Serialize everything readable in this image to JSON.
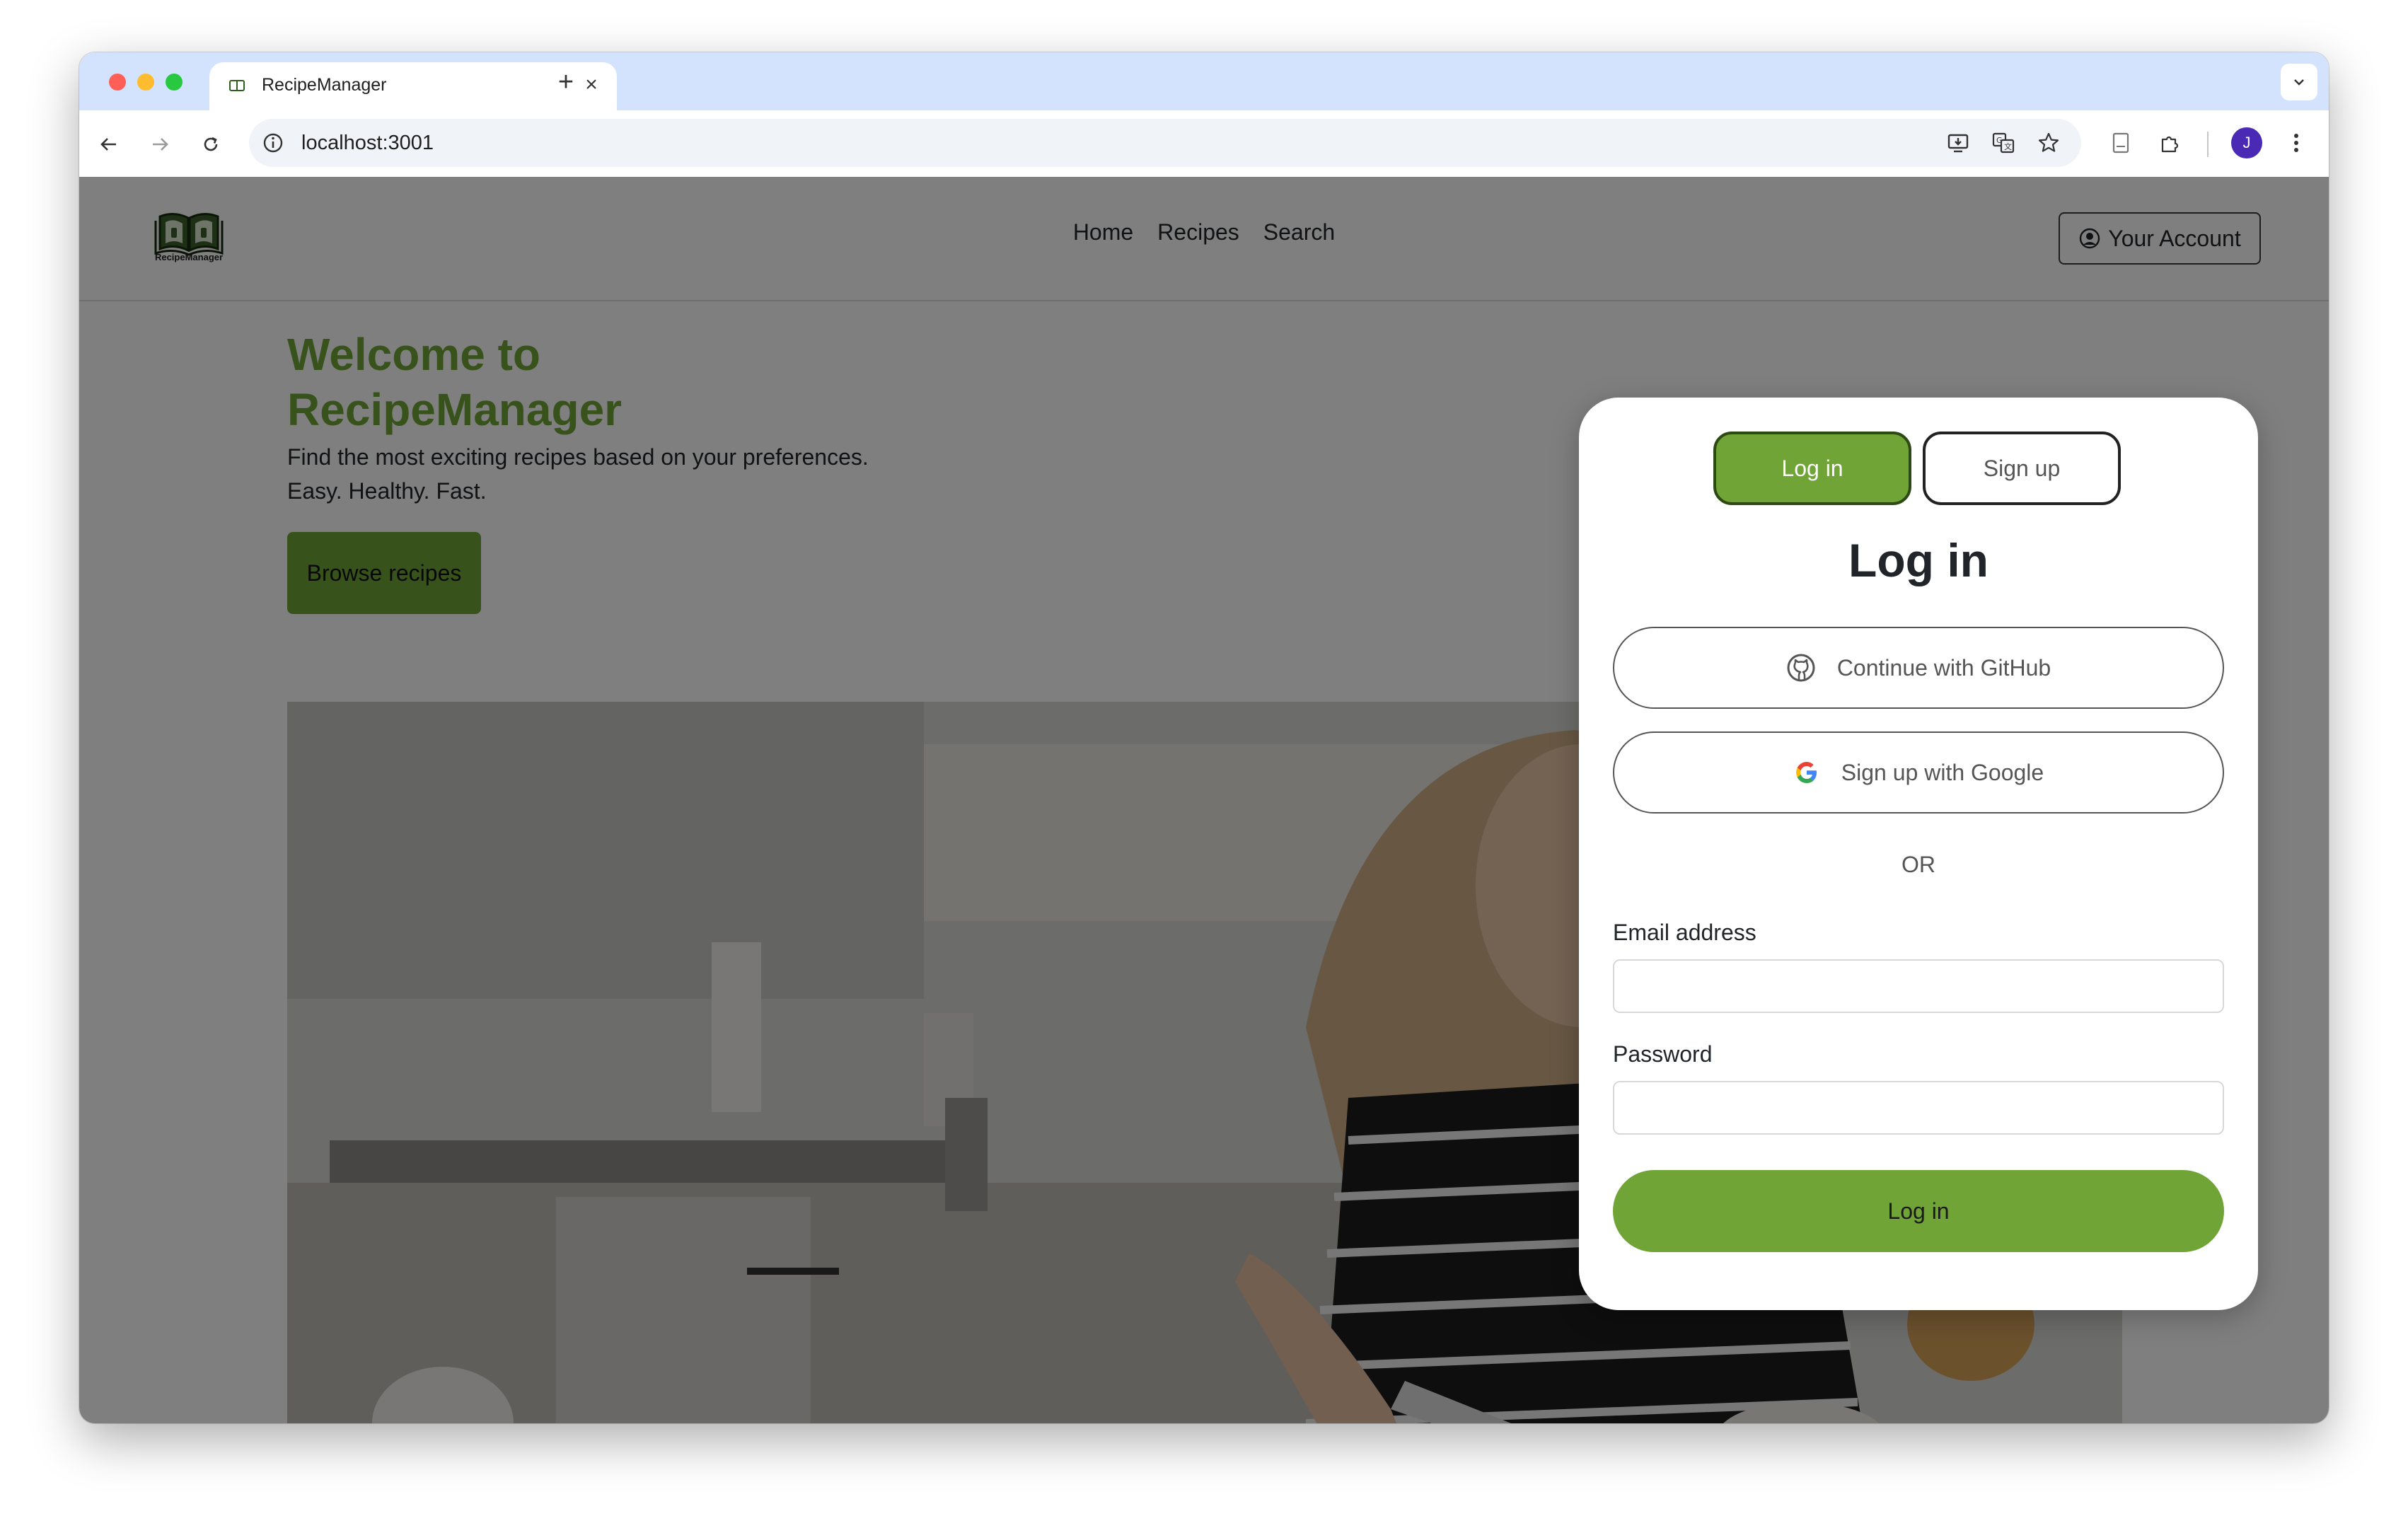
{
  "browser": {
    "tab_title": "RecipeManager",
    "url": "localhost:3001",
    "profile_initial": "J"
  },
  "site": {
    "logo_text": "RecipeManager",
    "nav": [
      "Home",
      "Recipes",
      "Search"
    ],
    "account_label": "Your Account"
  },
  "hero": {
    "title": "Welcome to RecipeManager",
    "line1": "Find the most exciting recipes based on your preferences.",
    "line2": "Easy. Healthy. Fast.",
    "browse_label": "Browse recipes"
  },
  "modal": {
    "tabs": {
      "login": "Log in",
      "signup": "Sign up"
    },
    "active_tab": "login",
    "heading": "Log in",
    "github_label": "Continue with GitHub",
    "google_label": "Sign up with Google",
    "or": "OR",
    "email_label": "Email address",
    "email_value": "",
    "password_label": "Password",
    "password_value": "",
    "submit_label": "Log in"
  },
  "colors": {
    "accent": "#71a436",
    "backdrop": "rgba(0,0,0,0.5)"
  }
}
